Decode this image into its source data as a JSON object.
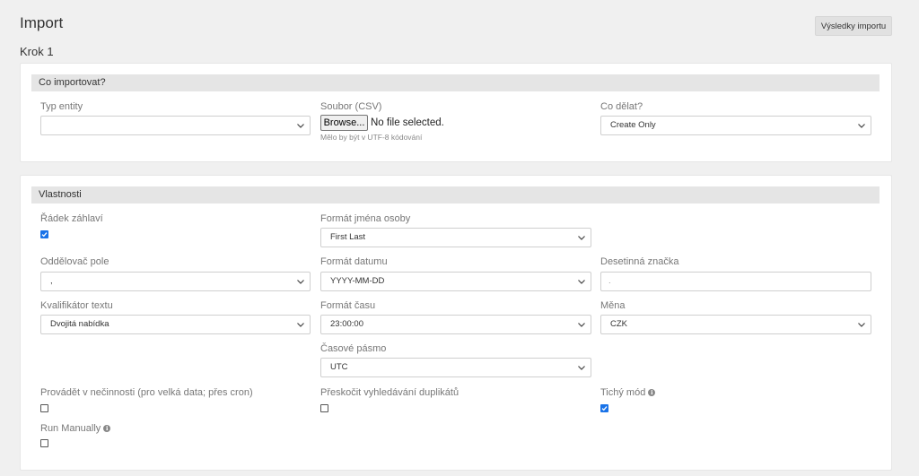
{
  "header": {
    "title": "Import",
    "results_button": "Výsledky importu",
    "step": "Krok 1"
  },
  "what_to_import": {
    "title": "Co importovat?",
    "entity_type": {
      "label": "Typ entity",
      "value": ""
    },
    "file": {
      "label": "Soubor (CSV)",
      "browse_label": "Browse...",
      "status": "No file selected.",
      "hint": "Mělo by být v UTF-8 kódování"
    },
    "action": {
      "label": "Co dělat?",
      "value": "Create Only"
    }
  },
  "properties": {
    "title": "Vlastnosti",
    "header_row": {
      "label": "Řádek záhlaví",
      "checked": true
    },
    "person_name_format": {
      "label": "Formát jména osoby",
      "value": "First Last"
    },
    "field_delimiter": {
      "label": "Oddělovač pole",
      "value": ","
    },
    "date_format": {
      "label": "Formát datumu",
      "value": "YYYY-MM-DD"
    },
    "decimal_mark": {
      "label": "Desetinná značka",
      "value": "."
    },
    "text_qualifier": {
      "label": "Kvalifikátor textu",
      "value": "Dvojitá nabídka"
    },
    "time_format": {
      "label": "Formát času",
      "value": "23:00:00"
    },
    "currency": {
      "label": "Měna",
      "value": "CZK"
    },
    "timezone": {
      "label": "Časové pásmo",
      "value": "UTC"
    },
    "idle_mode": {
      "label": "Provádět v nečinnosti (pro velká data; přes cron)",
      "checked": false
    },
    "skip_duplicates": {
      "label": "Přeskočit vyhledávání duplikátů",
      "checked": false
    },
    "silent_mode": {
      "label": "Tichý mód",
      "checked": true
    },
    "run_manually": {
      "label": "Run Manually",
      "checked": false
    }
  },
  "icons": {
    "chevron": "chevron-down-icon",
    "info": "info-icon",
    "check": "checkmark-icon"
  },
  "colors": {
    "background": "#f0f0f0",
    "panel_header": "#e5e5e5",
    "checkbox_checked": "#1a73e8"
  }
}
